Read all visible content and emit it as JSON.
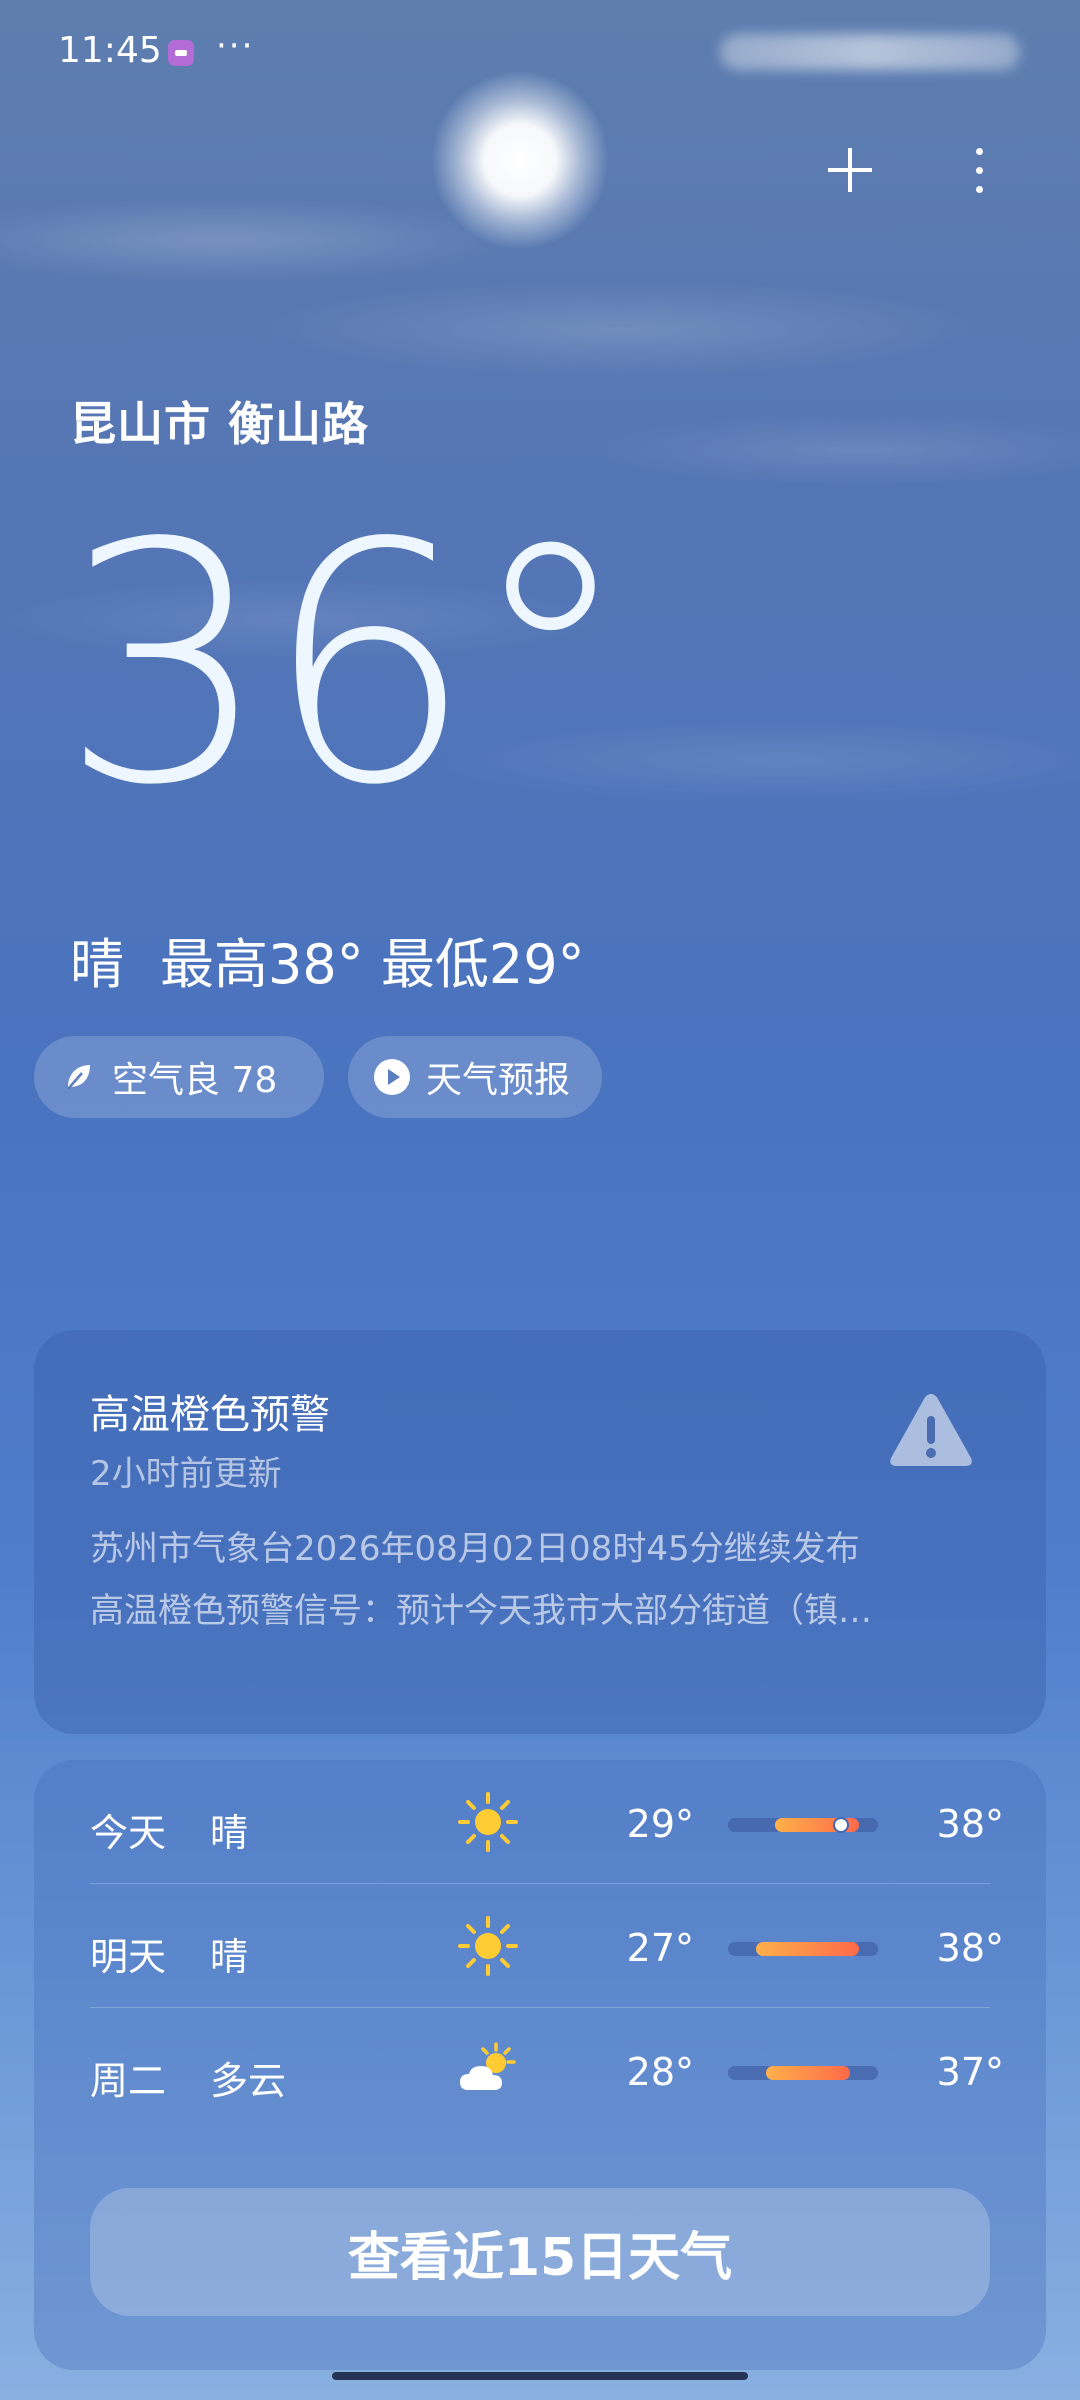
{
  "status_bar": {
    "time": "11:45",
    "more": "···"
  },
  "header": {
    "add_icon": "plus-icon",
    "more_icon": "vertical-dots-icon"
  },
  "location": "昆山市 衡山路",
  "current": {
    "temperature": "36°",
    "condition": "晴",
    "high": "最高38°",
    "low": "最低29°"
  },
  "chips": {
    "aqi": {
      "icon": "leaf-icon",
      "label": "空气良 78"
    },
    "forecast": {
      "icon": "play-icon",
      "label": "天气预报"
    }
  },
  "alert": {
    "title": "高温橙色预警",
    "updated": "2小时前更新",
    "icon": "warning-triangle-icon",
    "line1": "苏州市气象台2026年08月02日08时45分继续发布",
    "line2": "高温橙色预警信号：预计今天我市大部分街道（镇…"
  },
  "forecast": {
    "days": [
      {
        "day": "今天",
        "condition": "晴",
        "icon": "sun-icon",
        "low": "29°",
        "high": "38°",
        "low_value": 29,
        "high_value": 38,
        "current_value": 36
      },
      {
        "day": "明天",
        "condition": "晴",
        "icon": "sun-icon",
        "low": "27°",
        "high": "38°",
        "low_value": 27,
        "high_value": 38
      },
      {
        "day": "周二",
        "condition": "多云",
        "icon": "partly-cloudy-icon",
        "low": "28°",
        "high": "37°",
        "low_value": 28,
        "high_value": 37
      }
    ],
    "range_min": 24,
    "range_max": 40,
    "button_label": "查看近15日天气"
  },
  "colors": {
    "bar_warm_start": "#ffb04a",
    "bar_warm_end": "#ff6a4a",
    "sun": "#ffcc33"
  }
}
